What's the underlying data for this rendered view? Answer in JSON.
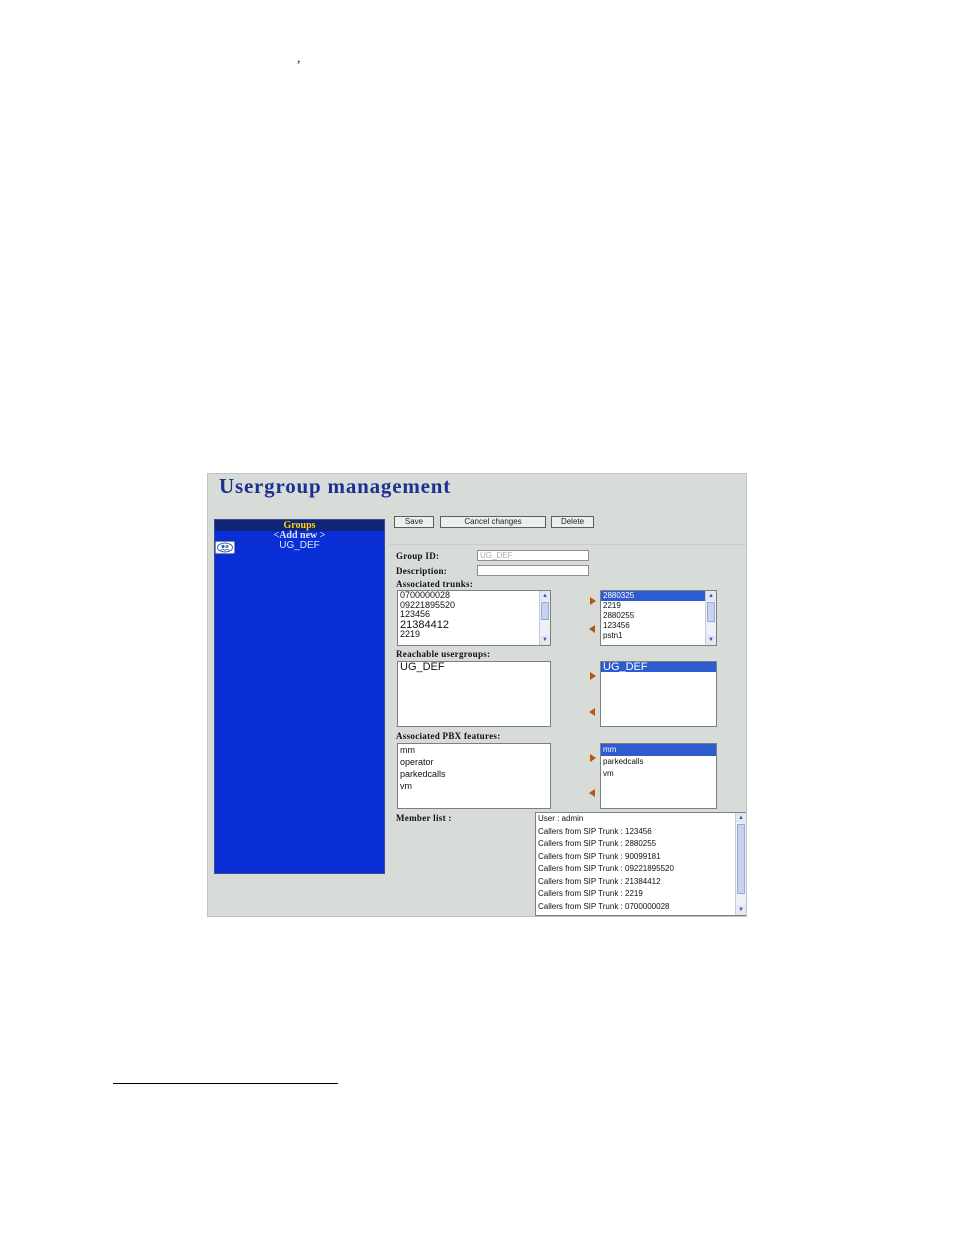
{
  "page": {
    "stray_mark": ","
  },
  "app": {
    "title": "Usergroup management"
  },
  "sidebar": {
    "header": "Groups",
    "add_new": "<Add new >",
    "groups": [
      {
        "label": "UG_DEF",
        "icon": "usergroup-icon"
      }
    ]
  },
  "toolbar": {
    "save_label": "Save",
    "cancel_label": "Cancel changes",
    "delete_label": "Delete"
  },
  "form": {
    "group_id_label": "Group ID:",
    "group_id_value": "UG_DEF",
    "description_label": "Description:",
    "description_value": "",
    "associated_trunks_label": "Associated trunks:",
    "available_trunks": [
      "0700000028",
      "09221895520",
      "123456",
      "21384412",
      "2219"
    ],
    "selected_trunks": [
      "2880325",
      "2219",
      "2880255",
      "123456",
      "pstn1"
    ],
    "reachable_usergroups_label": "Reachable usergroups:",
    "available_usergroups": [
      "UG_DEF"
    ],
    "selected_usergroups": [
      "UG_DEF"
    ],
    "pbx_features_label": "Associated PBX features:",
    "available_features": [
      "mm",
      "operator",
      "parkedcalls",
      "vm"
    ],
    "selected_features": [
      "mm",
      "parkedcalls",
      "vm"
    ],
    "member_list_label": "Member list :",
    "members": [
      "User : admin",
      "Callers from SIP Trunk : 123456",
      "Callers from SIP Trunk : 2880255",
      "Callers from SIP Trunk : 90099181",
      "Callers from SIP Trunk : 09221895520",
      "Callers from SIP Trunk : 21384412",
      "Callers from SIP Trunk : 2219",
      "Callers from SIP Trunk : 0700000028"
    ]
  },
  "colors": {
    "sidebar_bg": "#0a2ed6",
    "title": "#1d2f91",
    "selection": "#2f5bd0",
    "arrow": "#b8560d",
    "panel_bg": "#d8dcd9"
  }
}
